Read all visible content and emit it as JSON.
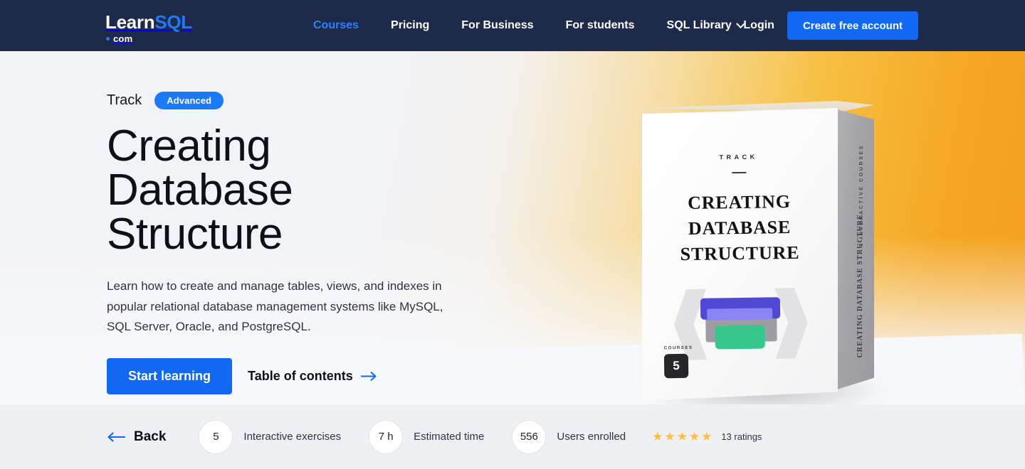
{
  "header": {
    "logo": {
      "learn": "Learn",
      "sql": "SQL",
      "com": "com"
    },
    "nav": [
      {
        "label": "Courses",
        "active": true,
        "caret": false
      },
      {
        "label": "Pricing",
        "active": false,
        "caret": false
      },
      {
        "label": "For Business",
        "active": false,
        "caret": false
      },
      {
        "label": "For students",
        "active": false,
        "caret": false
      },
      {
        "label": "SQL Library",
        "active": false,
        "caret": true
      }
    ],
    "login_label": "Login",
    "cta_label": "Create free account",
    "bg_color": "#1e2a4a",
    "accent_color": "#1168f2"
  },
  "hero": {
    "kicker": "Track",
    "level_badge": "Advanced",
    "title": "Creating Database Structure",
    "description": "Learn how to create and manage tables, views, and indexes in popular relational database management systems like MySQL, SQL Server, Oracle, and PostgreSQL.",
    "primary_button": "Start learning",
    "secondary_link": "Table of contents",
    "gradient_from": "#f2f3f7",
    "gradient_to": "#f5a623"
  },
  "box": {
    "kicker": "TRACK",
    "title": "CREATING DATABASE STRUCTURE",
    "courses_label": "COURSES",
    "courses_count": "5",
    "spine_top": "5 INTERACTIVE COURSES",
    "spine_bottom": "CREATING DATABASE STRUCTURE"
  },
  "stats": {
    "back_label": "Back",
    "items": [
      {
        "value": "5",
        "label": "Interactive exercises"
      },
      {
        "value": "7 h",
        "label": "Estimated time"
      },
      {
        "value": "556",
        "label": "Users enrolled"
      }
    ],
    "rating_stars": 5,
    "rating_star_glyph": "★",
    "rating_count_label": "13 ratings",
    "star_color": "#fbbf3c"
  }
}
